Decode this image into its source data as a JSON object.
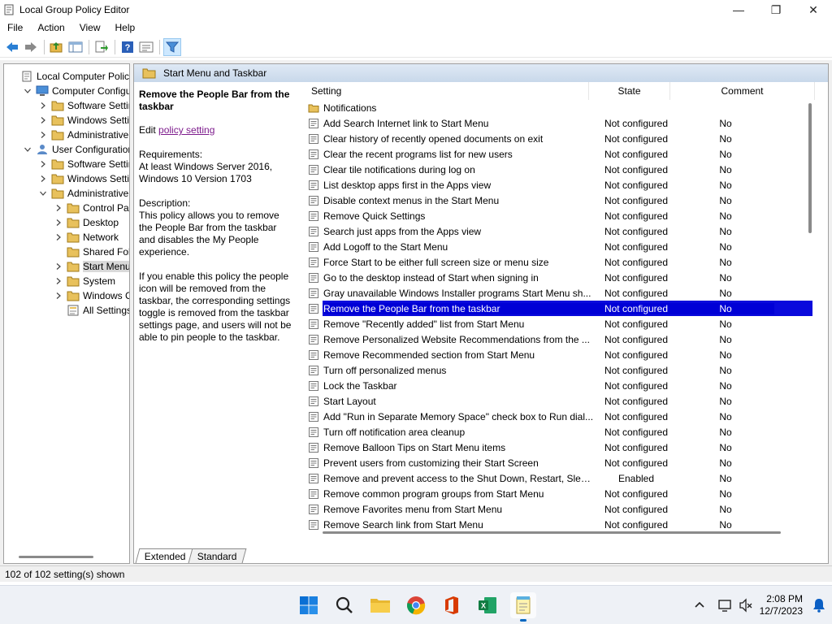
{
  "window": {
    "title": "Local Group Policy Editor",
    "controls": {
      "minimize": "—",
      "maximize": "❐",
      "close": "✕"
    }
  },
  "menu": [
    "File",
    "Action",
    "View",
    "Help"
  ],
  "toolbar": {
    "icons": [
      "back-icon",
      "forward-icon",
      "up-folder-icon",
      "show-hide-tree-icon",
      "export-list-icon",
      "help-icon",
      "properties-icon",
      "filter-icon"
    ]
  },
  "tree": {
    "items": [
      {
        "label": "Local Computer Policy",
        "indent": 0,
        "chevron": "",
        "icon": "policy"
      },
      {
        "label": "Computer Configura",
        "indent": 1,
        "chevron": "down",
        "icon": "computer"
      },
      {
        "label": "Software Settings",
        "indent": 2,
        "chevron": "right",
        "icon": "folder"
      },
      {
        "label": "Windows Setting",
        "indent": 2,
        "chevron": "right",
        "icon": "folder"
      },
      {
        "label": "Administrative Te",
        "indent": 2,
        "chevron": "right",
        "icon": "folder"
      },
      {
        "label": "User Configuration",
        "indent": 1,
        "chevron": "down",
        "icon": "user"
      },
      {
        "label": "Software Settings",
        "indent": 2,
        "chevron": "right",
        "icon": "folder"
      },
      {
        "label": "Windows Setting",
        "indent": 2,
        "chevron": "right",
        "icon": "folder"
      },
      {
        "label": "Administrative Te",
        "indent": 2,
        "chevron": "down",
        "icon": "folder"
      },
      {
        "label": "Control Panel",
        "indent": 3,
        "chevron": "right",
        "icon": "folder"
      },
      {
        "label": "Desktop",
        "indent": 3,
        "chevron": "right",
        "icon": "folder"
      },
      {
        "label": "Network",
        "indent": 3,
        "chevron": "right",
        "icon": "folder"
      },
      {
        "label": "Shared Folder",
        "indent": 3,
        "chevron": "",
        "icon": "folder"
      },
      {
        "label": "Start Menu ar",
        "indent": 3,
        "chevron": "right",
        "icon": "folder",
        "selected": true
      },
      {
        "label": "System",
        "indent": 3,
        "chevron": "right",
        "icon": "folder"
      },
      {
        "label": "Windows Cor",
        "indent": 3,
        "chevron": "right",
        "icon": "folder"
      },
      {
        "label": "All Settings",
        "indent": 3,
        "chevron": "",
        "icon": "allsettings"
      }
    ]
  },
  "panel": {
    "header": "Start Menu and Taskbar"
  },
  "description": {
    "title": "Remove the People Bar from the taskbar",
    "edit_prefix": "Edit ",
    "edit_link": "policy setting",
    "requirements_label": "Requirements:",
    "requirements": "At least Windows Server 2016, Windows 10 Version 1703",
    "description_label": "Description:",
    "description": "This policy allows you to remove the People Bar from the taskbar and disables the My People experience.",
    "details": "If you enable this policy the people icon will be removed from the taskbar, the corresponding settings toggle is removed from the taskbar settings page, and users will not be able to pin people to the taskbar."
  },
  "list": {
    "columns": {
      "setting": "Setting",
      "state": "State",
      "comment": "Comment"
    },
    "folder_row": "Notifications",
    "rows": [
      {
        "name": "Add Search Internet link to Start Menu",
        "state": "Not configured",
        "comment": "No"
      },
      {
        "name": "Clear history of recently opened documents on exit",
        "state": "Not configured",
        "comment": "No"
      },
      {
        "name": "Clear the recent programs list for new users",
        "state": "Not configured",
        "comment": "No"
      },
      {
        "name": "Clear tile notifications during log on",
        "state": "Not configured",
        "comment": "No"
      },
      {
        "name": "List desktop apps first in the Apps view",
        "state": "Not configured",
        "comment": "No"
      },
      {
        "name": "Disable context menus in the Start Menu",
        "state": "Not configured",
        "comment": "No"
      },
      {
        "name": "Remove Quick Settings",
        "state": "Not configured",
        "comment": "No"
      },
      {
        "name": "Search just apps from the Apps view",
        "state": "Not configured",
        "comment": "No"
      },
      {
        "name": "Add Logoff to the Start Menu",
        "state": "Not configured",
        "comment": "No"
      },
      {
        "name": "Force Start to be either full screen size or menu size",
        "state": "Not configured",
        "comment": "No"
      },
      {
        "name": "Go to the desktop instead of Start when signing in",
        "state": "Not configured",
        "comment": "No"
      },
      {
        "name": "Gray unavailable Windows Installer programs Start Menu sh...",
        "state": "Not configured",
        "comment": "No"
      },
      {
        "name": "Remove the People Bar from the taskbar",
        "state": "Not configured",
        "comment": "No",
        "selected": true
      },
      {
        "name": "Remove \"Recently added\" list from Start Menu",
        "state": "Not configured",
        "comment": "No"
      },
      {
        "name": "Remove Personalized Website Recommendations from the ...",
        "state": "Not configured",
        "comment": "No"
      },
      {
        "name": "Remove Recommended section from Start Menu",
        "state": "Not configured",
        "comment": "No"
      },
      {
        "name": "Turn off personalized menus",
        "state": "Not configured",
        "comment": "No"
      },
      {
        "name": "Lock the Taskbar",
        "state": "Not configured",
        "comment": "No"
      },
      {
        "name": "Start Layout",
        "state": "Not configured",
        "comment": "No"
      },
      {
        "name": "Add \"Run in Separate Memory Space\" check box to Run dial...",
        "state": "Not configured",
        "comment": "No"
      },
      {
        "name": "Turn off notification area cleanup",
        "state": "Not configured",
        "comment": "No"
      },
      {
        "name": "Remove Balloon Tips on Start Menu items",
        "state": "Not configured",
        "comment": "No"
      },
      {
        "name": "Prevent users from customizing their Start Screen",
        "state": "Not configured",
        "comment": "No"
      },
      {
        "name": "Remove and prevent access to the Shut Down, Restart, Sleep...",
        "state": "Enabled",
        "comment": "No"
      },
      {
        "name": "Remove common program groups from Start Menu",
        "state": "Not configured",
        "comment": "No"
      },
      {
        "name": "Remove Favorites menu from Start Menu",
        "state": "Not configured",
        "comment": "No"
      },
      {
        "name": "Remove Search link from Start Menu",
        "state": "Not configured",
        "comment": "No"
      }
    ]
  },
  "tabs": [
    "Extended",
    "Standard"
  ],
  "status": "102 of 102 setting(s) shown",
  "taskbar": {
    "apps": [
      "start-icon",
      "search-icon",
      "file-explorer-icon",
      "chrome-icon",
      "office-icon",
      "excel-icon",
      "notepad-icon"
    ],
    "time": "2:08 PM",
    "date": "12/7/2023"
  },
  "colors": {
    "selection": "#0000d6",
    "link": "#7d1b8c",
    "header_gradient": "#c8d8ea"
  }
}
